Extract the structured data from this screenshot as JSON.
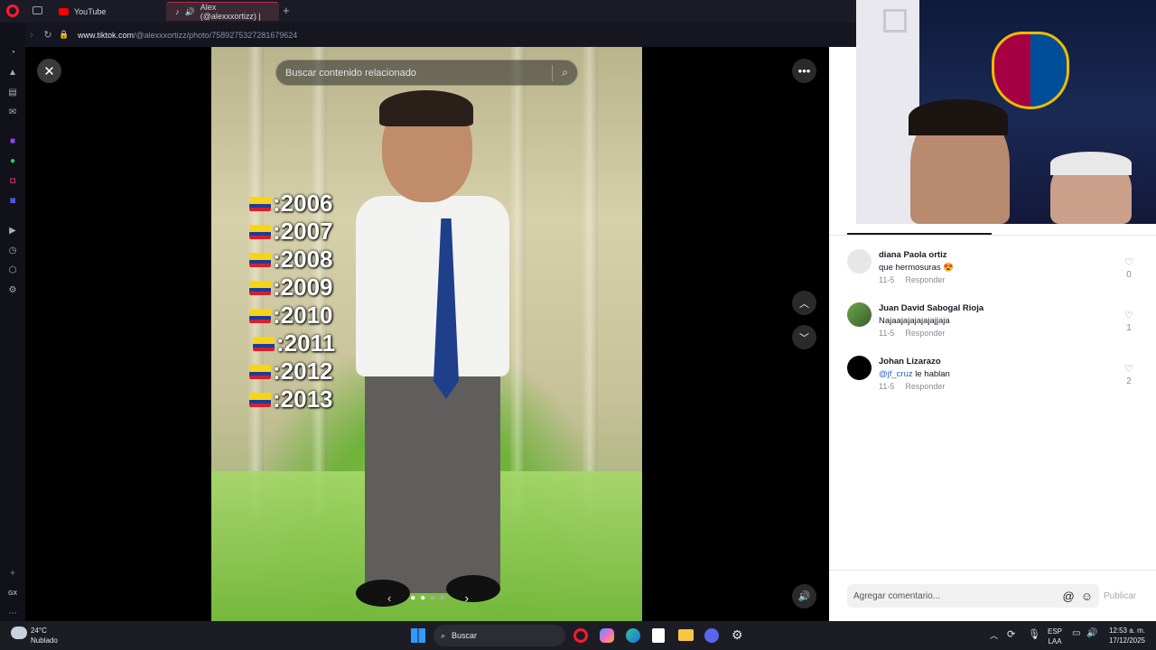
{
  "tabs": [
    {
      "label": "YouTube",
      "icon": "youtube-icon"
    },
    {
      "label": "Alex (@alexxxortizz) |",
      "icon": "tiktok-icon"
    }
  ],
  "address": {
    "domain": "www.tiktok.com",
    "path": "/@alexxxortizz/photo/7589275327281679624"
  },
  "search": {
    "placeholder": "Buscar contenido relacionado"
  },
  "overlay_years": [
    ":2006",
    ":2007",
    ":2008",
    ":2009",
    ":2010",
    ":2011",
    ":2012",
    ":2013"
  ],
  "comments": [
    {
      "name": "diana Paola ortiz",
      "text": "que hermosuras 😍",
      "date": "11-5",
      "reply": "Responder",
      "likes": "0"
    },
    {
      "name": "Juan David Sabogal Rioja",
      "text": "Najaajajajajajajjaja",
      "date": "11-5",
      "reply": "Responder",
      "likes": "1"
    },
    {
      "name": "Johan Lizarazo",
      "mention": "@jf_cruz",
      "text": " le hablan",
      "date": "11-5",
      "reply": "Responder",
      "likes": "2"
    }
  ],
  "comment_input": {
    "placeholder": "Agregar comentario...",
    "publish": "Publicar"
  },
  "taskbar": {
    "weather_temp": "24°C",
    "weather_desc": "Nublado",
    "search_label": "Buscar",
    "lang_top": "ESP",
    "lang_bottom": "LAA",
    "time": "12:53 a. m.",
    "date": "17/12/2025"
  },
  "sidebar_gx": "GX",
  "colors": {
    "opera_red": "#ff1b2d",
    "tiktok_panel": "#ffffff",
    "taskbar": "#1c1d24"
  }
}
